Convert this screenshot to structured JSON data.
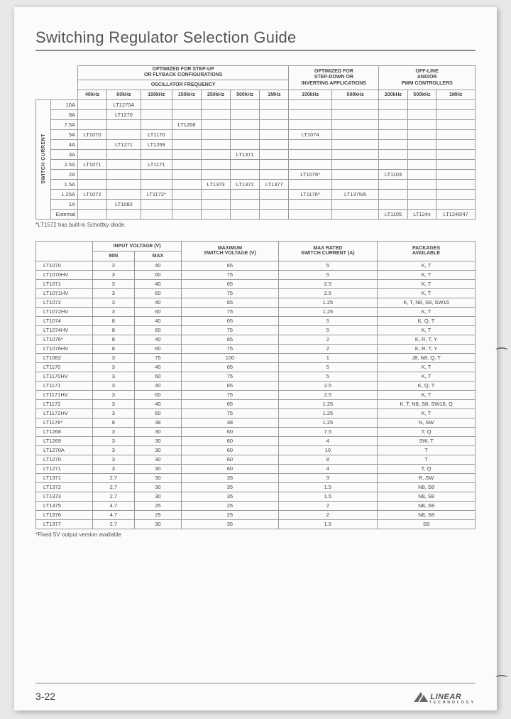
{
  "title": "Switching Regulator Selection Guide",
  "page_number": "3-22",
  "brand": "LINEAR",
  "brand_sub": "TECHNOLOGY",
  "footnote1": "*LT1572 has built-in Schottky diode.",
  "footnote2": "*Fixed 5V output version available",
  "chart_data": {
    "table1": {
      "group_headers": [
        "OPTIMIZED FOR STEP-UP\nOR FLYBACK CONFIGURATIONS",
        "OPTIMIZED FOR\nSTEP-DOWN OR\nINVERTING APPLICATIONS",
        "OFF-LINE\nAND/OR\nPWM CONTROLLERS"
      ],
      "mid_header": "OSCILLATOR FREQUENCY",
      "freq_cols": [
        "40kHz",
        "60kHz",
        "100kHz",
        "150kHz",
        "250kHz",
        "500kHz",
        "1MHz",
        "100kHz",
        "500kHz",
        "200kHz",
        "500kHz",
        "1MHz"
      ],
      "side_label": "SWITCH CURRENT",
      "rows": [
        {
          "label": "10A",
          "cells": [
            "",
            "LT1270A",
            "",
            "",
            "",
            "",
            "",
            "",
            "",
            "",
            "",
            ""
          ]
        },
        {
          "label": "8A",
          "cells": [
            "",
            "LT1270",
            "",
            "",
            "",
            "",
            "",
            "",
            "",
            "",
            "",
            ""
          ]
        },
        {
          "label": "7.5A",
          "cells": [
            "",
            "",
            "",
            "LT1268",
            "",
            "",
            "",
            "",
            "",
            "",
            "",
            ""
          ]
        },
        {
          "label": "5A",
          "cells": [
            "LT1070",
            "",
            "LT1170",
            "",
            "",
            "",
            "",
            "LT1074",
            "",
            "",
            "",
            ""
          ]
        },
        {
          "label": "4A",
          "cells": [
            "",
            "LT1271",
            "LT1269",
            "",
            "",
            "",
            "",
            "",
            "",
            "",
            "",
            ""
          ]
        },
        {
          "label": "3A",
          "cells": [
            "",
            "",
            "",
            "",
            "",
            "LT1371",
            "",
            "",
            "",
            "",
            "",
            ""
          ]
        },
        {
          "label": "2.5A",
          "cells": [
            "LT1071",
            "",
            "LT1171",
            "",
            "",
            "",
            "",
            "",
            "",
            "",
            "",
            ""
          ]
        },
        {
          "label": "2A",
          "cells": [
            "",
            "",
            "",
            "",
            "",
            "",
            "",
            "LT1076*",
            "",
            "LT1103",
            "",
            ""
          ]
        },
        {
          "label": "1.5A",
          "cells": [
            "",
            "",
            "",
            "",
            "LT1373",
            "LT1372",
            "LT1377",
            "",
            "",
            "",
            "",
            ""
          ]
        },
        {
          "label": "1.25A",
          "cells": [
            "LT1072",
            "",
            "LT1172*",
            "",
            "",
            "",
            "",
            "LT1176*",
            "LT1375/6",
            "",
            "",
            ""
          ]
        },
        {
          "label": "1A",
          "cells": [
            "",
            "LT1082",
            "",
            "",
            "",
            "",
            "",
            "",
            "",
            "",
            "",
            ""
          ]
        },
        {
          "label": "External",
          "cells": [
            "",
            "",
            "",
            "",
            "",
            "",
            "",
            "",
            "",
            "LT1105",
            "LT124x",
            "LT1246/47"
          ]
        }
      ]
    },
    "table2": {
      "headers": {
        "c1": "",
        "c2": "INPUT VOLTAGE (V)",
        "c2a": "MIN",
        "c2b": "MAX",
        "c3": "MAXIMUM\nSWITCH VOLTAGE (V)",
        "c4": "MAX RATED\nSWITCH CURRENT (A)",
        "c5": "PACKAGES\nAVAILABLE"
      },
      "rows": [
        {
          "part": "LT1070",
          "min": "3",
          "max": "40",
          "sv": "65",
          "sc": "5",
          "pkg": "K, T"
        },
        {
          "part": "LT1070HV",
          "min": "3",
          "max": "60",
          "sv": "75",
          "sc": "5",
          "pkg": "K, T"
        },
        {
          "part": "LT1071",
          "min": "3",
          "max": "40",
          "sv": "65",
          "sc": "2.5",
          "pkg": "K, T"
        },
        {
          "part": "LT1071HV",
          "min": "3",
          "max": "60",
          "sv": "75",
          "sc": "2.5",
          "pkg": "K, T"
        },
        {
          "part": "LT1072",
          "min": "3",
          "max": "40",
          "sv": "65",
          "sc": "1.25",
          "pkg": "K, T, N8, S8, SW16"
        },
        {
          "part": "LT1072HV",
          "min": "3",
          "max": "60",
          "sv": "75",
          "sc": "1.25",
          "pkg": "K, T"
        },
        {
          "part": "LT1074",
          "min": "8",
          "max": "40",
          "sv": "65",
          "sc": "5",
          "pkg": "K, Q, T"
        },
        {
          "part": "LT1074HV",
          "min": "8",
          "max": "60",
          "sv": "75",
          "sc": "5",
          "pkg": "K, T"
        },
        {
          "part": "LT1076*",
          "min": "8",
          "max": "40",
          "sv": "65",
          "sc": "2",
          "pkg": "K, R, T, Y"
        },
        {
          "part": "LT1076HV",
          "min": "8",
          "max": "60",
          "sv": "75",
          "sc": "2",
          "pkg": "K, R, T, Y"
        },
        {
          "part": "LT1082",
          "min": "3",
          "max": "75",
          "sv": "100",
          "sc": "1",
          "pkg": "J8, N8, Q, T"
        },
        {
          "part": "LT1170",
          "min": "3",
          "max": "40",
          "sv": "65",
          "sc": "5",
          "pkg": "K, T"
        },
        {
          "part": "LT1170HV",
          "min": "3",
          "max": "60",
          "sv": "75",
          "sc": "5",
          "pkg": "K, T"
        },
        {
          "part": "LT1171",
          "min": "3",
          "max": "40",
          "sv": "65",
          "sc": "2.5",
          "pkg": "K, Q, T"
        },
        {
          "part": "LT1171HV",
          "min": "3",
          "max": "60",
          "sv": "75",
          "sc": "2.5",
          "pkg": "K, T"
        },
        {
          "part": "LT1172",
          "min": "3",
          "max": "40",
          "sv": "65",
          "sc": "1.25",
          "pkg": "K, T, N8, S8, SW16, Q"
        },
        {
          "part": "LT1172HV",
          "min": "3",
          "max": "60",
          "sv": "75",
          "sc": "1.25",
          "pkg": "K, T"
        },
        {
          "part": "LT1176*",
          "min": "8",
          "max": "38",
          "sv": "38",
          "sc": "1.25",
          "pkg": "N, SW"
        },
        {
          "part": "LT1268",
          "min": "3",
          "max": "30",
          "sv": "60",
          "sc": "7.5",
          "pkg": "T, Q"
        },
        {
          "part": "LT1269",
          "min": "3",
          "max": "30",
          "sv": "60",
          "sc": "4",
          "pkg": "SW, T"
        },
        {
          "part": "LT1270A",
          "min": "3",
          "max": "30",
          "sv": "60",
          "sc": "10",
          "pkg": "T"
        },
        {
          "part": "LT1270",
          "min": "3",
          "max": "30",
          "sv": "60",
          "sc": "8",
          "pkg": "T"
        },
        {
          "part": "LT1271",
          "min": "3",
          "max": "30",
          "sv": "60",
          "sc": "4",
          "pkg": "T, Q"
        },
        {
          "part": "LT1371",
          "min": "2.7",
          "max": "30",
          "sv": "35",
          "sc": "3",
          "pkg": "R, SW"
        },
        {
          "part": "LT1372",
          "min": "2.7",
          "max": "30",
          "sv": "35",
          "sc": "1.5",
          "pkg": "N8, S8"
        },
        {
          "part": "LT1373",
          "min": "2.7",
          "max": "30",
          "sv": "35",
          "sc": "1.5",
          "pkg": "N8, S8"
        },
        {
          "part": "LT1375",
          "min": "4.7",
          "max": "25",
          "sv": "25",
          "sc": "2",
          "pkg": "N8, S8"
        },
        {
          "part": "LT1376",
          "min": "4.7",
          "max": "25",
          "sv": "25",
          "sc": "2",
          "pkg": "N8, S8"
        },
        {
          "part": "LT1377",
          "min": "2.7",
          "max": "30",
          "sv": "35",
          "sc": "1.5",
          "pkg": "S8"
        }
      ]
    }
  }
}
